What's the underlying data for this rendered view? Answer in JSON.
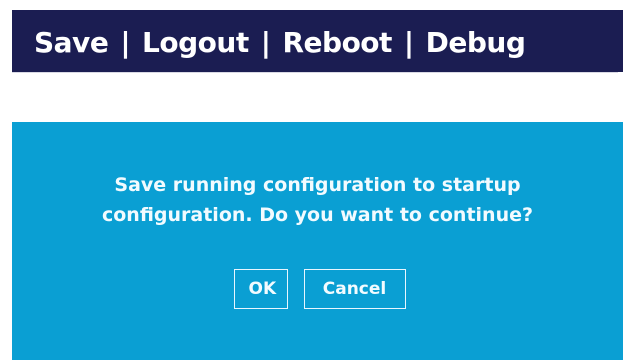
{
  "topbar": {
    "links": [
      "Save",
      "Logout",
      "Reboot",
      "Debug"
    ],
    "separator": "|"
  },
  "dialog": {
    "message": "Save running configuration to startup\nconfiguration. Do you want to continue?",
    "ok_label": "OK",
    "cancel_label": "Cancel"
  },
  "colors": {
    "topbar_bg": "#1b1d52",
    "dialog_bg": "#0a9fd3",
    "text": "#ffffff"
  }
}
